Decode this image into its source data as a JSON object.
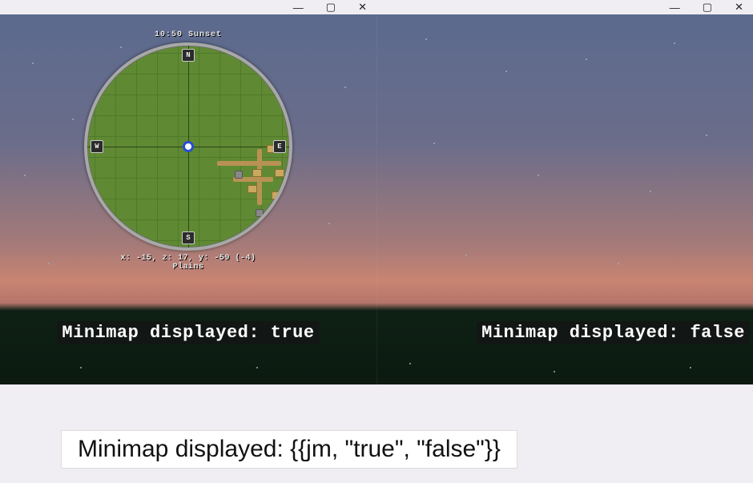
{
  "titlebar": {
    "minimize_glyph": "—",
    "maximize_glyph": "▢",
    "close_glyph": "✕"
  },
  "minimap": {
    "time_text": "10:50 Sunset",
    "compass": {
      "n": "N",
      "s": "S",
      "e": "E",
      "w": "W"
    },
    "coords": "x: -15, z: 17, y: -59 (-4)",
    "biome": "Plains"
  },
  "captions": {
    "left": "Minimap displayed: true",
    "right": "Minimap displayed: false"
  },
  "template_string": "Minimap displayed: {{jm, \"true\", \"false\"}}"
}
